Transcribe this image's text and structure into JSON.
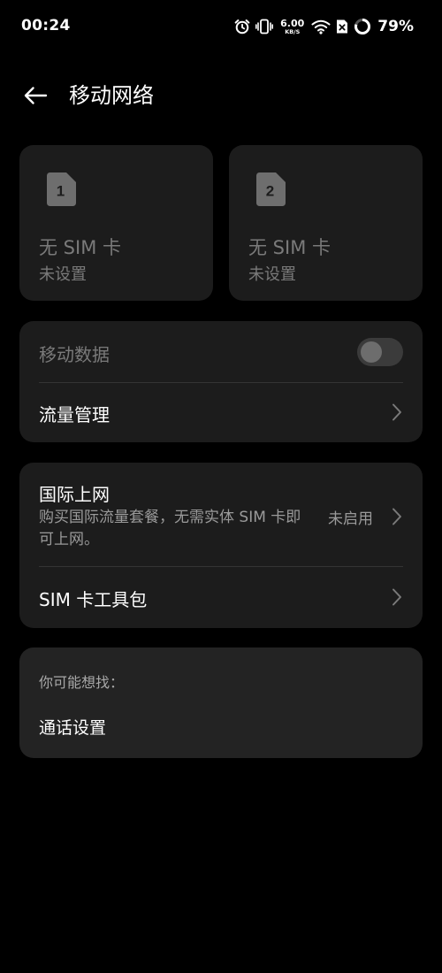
{
  "status_bar": {
    "time": "00:24",
    "speed_value": "6.00",
    "speed_unit": "KB/S",
    "battery": "79%"
  },
  "header": {
    "title": "移动网络"
  },
  "sim_cards": [
    {
      "number": "1",
      "title": "无 SIM 卡",
      "subtitle": "未设置"
    },
    {
      "number": "2",
      "title": "无 SIM 卡",
      "subtitle": "未设置"
    }
  ],
  "data_section": {
    "mobile_data_label": "移动数据",
    "mobile_data_enabled": false,
    "traffic_label": "流量管理"
  },
  "roaming_section": {
    "title": "国际上网",
    "description": "购买国际流量套餐，无需实体 SIM 卡即可上网。",
    "status": "未启用",
    "toolkit_label": "SIM 卡工具包"
  },
  "suggestions": {
    "heading": "你可能想找：",
    "items": [
      "通话设置"
    ]
  },
  "colors": {
    "background": "#000000",
    "card": "#1c1c1c",
    "text_primary": "#ffffff",
    "text_disabled": "#7a7a7a"
  }
}
